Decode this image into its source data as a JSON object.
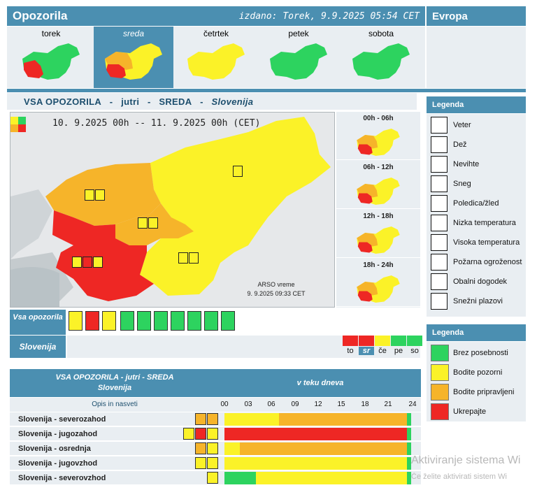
{
  "header": {
    "title": "Opozorila",
    "issued": "izdano: Torek, 9.9.2025 05:54 CET",
    "europe_tab": "Evropa"
  },
  "days": [
    {
      "label": "torek",
      "selected": false
    },
    {
      "label": "sreda",
      "selected": true
    },
    {
      "label": "četrtek",
      "selected": false
    },
    {
      "label": "petek",
      "selected": false
    },
    {
      "label": "sobota",
      "selected": false
    }
  ],
  "section": {
    "title_parts": [
      "VSA OPOZORILA",
      "-",
      "jutri",
      "-",
      "SREDA",
      "-",
      "Slovenija"
    ]
  },
  "map": {
    "period": "10. 9.2025 00h -- 11. 9.2025 00h   (CET)",
    "source": "ARSO vreme",
    "timestamp": "9. 9.2025  09:33 CET"
  },
  "period_maps": [
    {
      "label": "00h - 06h"
    },
    {
      "label": "06h - 12h"
    },
    {
      "label": "12h - 18h"
    },
    {
      "label": "18h - 24h"
    }
  ],
  "legend1": {
    "title": "Legenda",
    "items": [
      {
        "icon": "wind-icon",
        "label": "Veter"
      },
      {
        "icon": "rain-icon",
        "label": "Dež"
      },
      {
        "icon": "thunderstorm-icon",
        "label": "Nevihte"
      },
      {
        "icon": "snow-icon",
        "label": "Sneg"
      },
      {
        "icon": "ice-icon",
        "label": "Poledica/žled"
      },
      {
        "icon": "low-temperature-icon",
        "label": "Nizka temperatura"
      },
      {
        "icon": "high-temperature-icon",
        "label": "Visoka temperatura"
      },
      {
        "icon": "fire-icon",
        "label": "Požarna ogroženost"
      },
      {
        "icon": "coastal-icon",
        "label": "Obalni dogodek"
      },
      {
        "icon": "avalanche-icon",
        "label": "Snežni plazovi"
      }
    ]
  },
  "legend2": {
    "title": "Legenda",
    "items": [
      {
        "color": "#2dd35f",
        "label": "Brez posebnosti"
      },
      {
        "color": "#fbf228",
        "label": "Bodite pozorni"
      },
      {
        "color": "#f6b42a",
        "label": "Bodite pripravljeni"
      },
      {
        "color": "#ee2724",
        "label": "Ukrepajte"
      }
    ]
  },
  "vsa_row": {
    "label": "Vsa opozorila"
  },
  "slovenija_row": {
    "label": "Slovenija",
    "days": [
      {
        "label": "to",
        "color": "#ee2724",
        "current": false
      },
      {
        "label": "sr",
        "color": "#ee2724",
        "current": true
      },
      {
        "label": "če",
        "color": "#fbf228",
        "current": false
      },
      {
        "label": "pe",
        "color": "#2dd35f",
        "current": false
      },
      {
        "label": "so",
        "color": "#2dd35f",
        "current": false
      }
    ]
  },
  "table": {
    "title_line1": "VSA OPOZORILA - jutri - SREDA",
    "title_line2": "Slovenija",
    "timeline_title": "v teku dneva",
    "desc_header": "Opis in nasveti",
    "hours": [
      "00",
      "03",
      "06",
      "09",
      "12",
      "15",
      "18",
      "21",
      "24"
    ],
    "rows": [
      {
        "name": "Slovenija - severozahod",
        "icons": [
          "rain-icon",
          "thunderstorm-icon"
        ],
        "segments": [
          {
            "hours": 7,
            "color": "#fbf228"
          },
          {
            "hours": 16.5,
            "color": "#f6b42a"
          },
          {
            "hours": 0.5,
            "color": "#2dd35f"
          }
        ]
      },
      {
        "name": "Slovenija - jugozahod",
        "icons": [
          "wind-icon",
          "rain-icon",
          "thunderstorm-icon"
        ],
        "segments": [
          {
            "hours": 23.5,
            "color": "#ee2724"
          },
          {
            "hours": 0.5,
            "color": "#2dd35f"
          }
        ]
      },
      {
        "name": "Slovenija - osrednja",
        "icons": [
          "rain-icon",
          "thunderstorm-icon"
        ],
        "segments": [
          {
            "hours": 2,
            "color": "#fbf228"
          },
          {
            "hours": 21.5,
            "color": "#f6b42a"
          },
          {
            "hours": 0.5,
            "color": "#2dd35f"
          }
        ]
      },
      {
        "name": "Slovenija - jugovzhod",
        "icons": [
          "rain-icon",
          "thunderstorm-icon"
        ],
        "segments": [
          {
            "hours": 23.5,
            "color": "#fbf228"
          },
          {
            "hours": 0.5,
            "color": "#2dd35f"
          }
        ]
      },
      {
        "name": "Slovenija - severovzhod",
        "icons": [
          "thunderstorm-icon"
        ],
        "segments": [
          {
            "hours": 4,
            "color": "#2dd35f"
          },
          {
            "hours": 19.5,
            "color": "#fbf228"
          },
          {
            "hours": 0.5,
            "color": "#2dd35f"
          }
        ]
      }
    ]
  },
  "watermark": {
    "line1": "Aktiviranje sistema Wi",
    "line2": "Če želite aktivirati sistem Wi"
  }
}
